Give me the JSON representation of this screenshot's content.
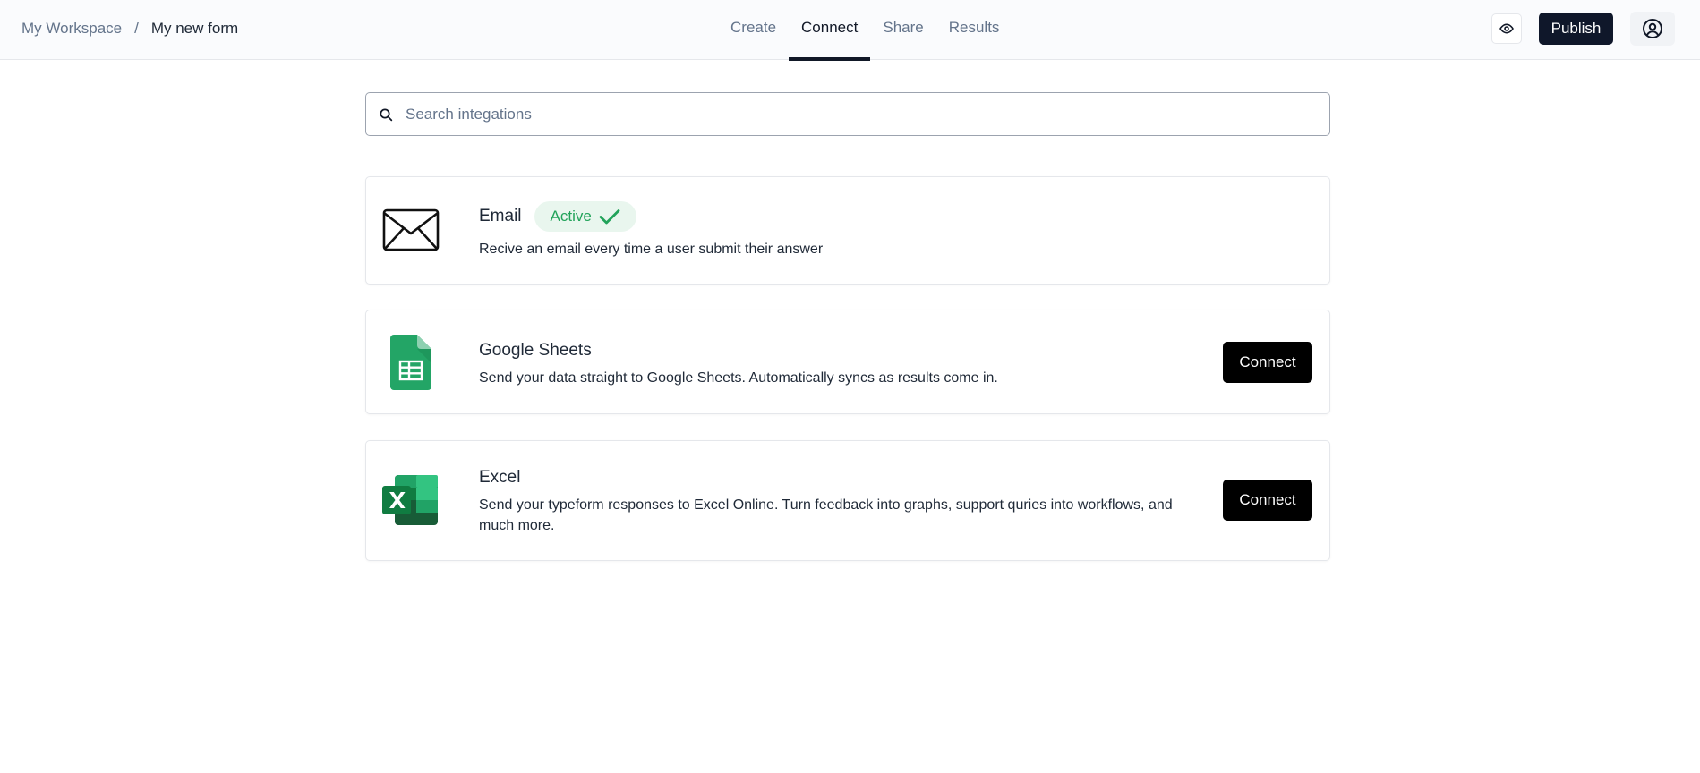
{
  "breadcrumb": {
    "root": "My Workspace",
    "separator": "/",
    "current": "My new form"
  },
  "tabs": [
    {
      "label": "Create",
      "active": false
    },
    {
      "label": "Connect",
      "active": true
    },
    {
      "label": "Share",
      "active": false
    },
    {
      "label": "Results",
      "active": false
    }
  ],
  "header": {
    "preview_icon": "eye-icon",
    "publish_label": "Publish",
    "account_icon": "user-circle-icon"
  },
  "search": {
    "placeholder": "Search integations",
    "value": "",
    "icon": "search-icon"
  },
  "integrations": [
    {
      "name": "Email",
      "icon": "envelope-icon",
      "status": "Active",
      "description": "Recive an email every time a user submit their answer"
    },
    {
      "name": "Google Sheets",
      "icon": "google-sheets-icon",
      "button": "Connect",
      "description": "Send your data straight to Google Sheets. Automatically syncs as results come in."
    },
    {
      "name": "Excel",
      "icon": "excel-icon",
      "button": "Connect",
      "description": "Send your typeform responses to Excel Online. Turn feedback into graphs, support quries into workflows, and much more."
    }
  ],
  "colors": {
    "publish_bg": "#0f172a",
    "active_badge_bg": "#e9f6ee",
    "active_badge_text": "#22a35a",
    "connect_bg": "#000000",
    "sheets_green": "#23a566",
    "excel_green": "#107c41"
  }
}
